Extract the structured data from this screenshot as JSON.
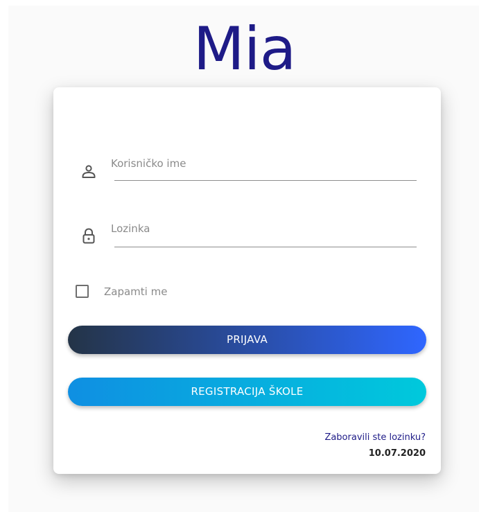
{
  "app": {
    "logo_text": "Mia",
    "brand_color": "#1e1b87"
  },
  "login_form": {
    "username": {
      "label": "Korisničko ime",
      "icon": "user-icon",
      "value": ""
    },
    "password": {
      "label": "Lozinka",
      "icon": "lock-icon",
      "value": ""
    },
    "remember_me": {
      "label": "Zapamti me",
      "checked": false
    },
    "login_button_label": "PRIJAVA",
    "register_button_label": "REGISTRACIJA ŠKOLE",
    "forgot_password_link": "Zaboravili ste lozinku?",
    "date": "10.07.2020"
  },
  "colors": {
    "login_gradient_start": "#243447",
    "login_gradient_end": "#2f66ff",
    "register_gradient_start": "#0f8fe2",
    "register_gradient_end": "#00c9dc"
  }
}
